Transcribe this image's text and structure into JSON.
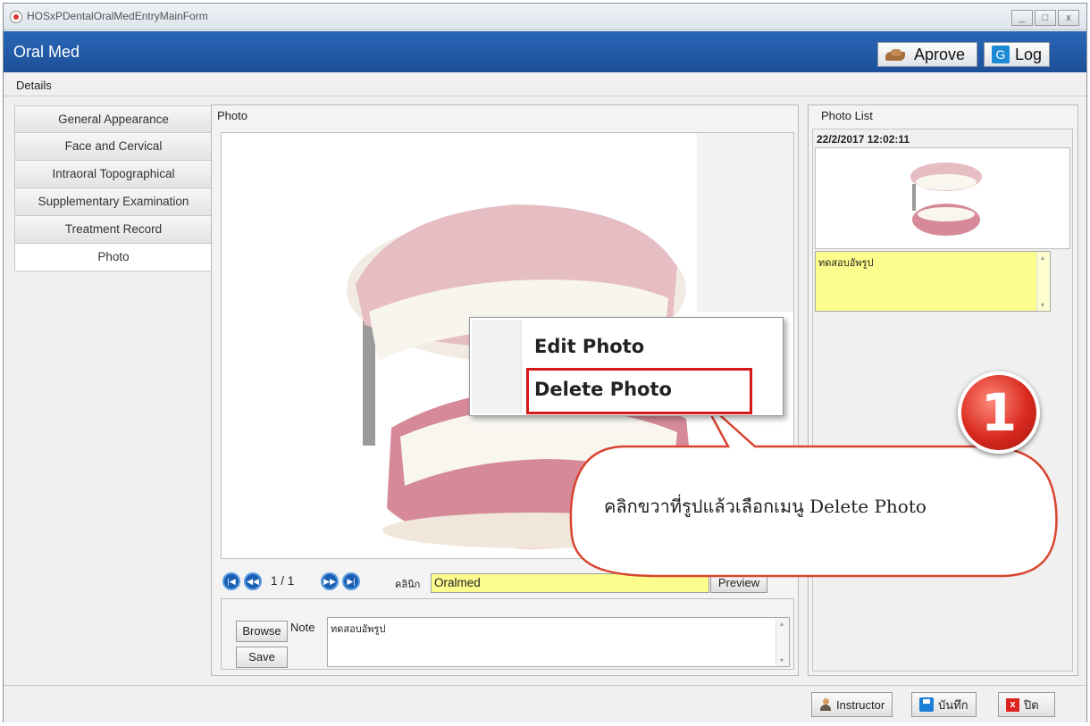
{
  "window": {
    "title": "HOSxPDentalOralMedEntryMainForm",
    "buttons": [
      "_",
      "□",
      "x"
    ]
  },
  "header": {
    "title": "Oral Med",
    "approve_label": "Aprove",
    "log_label": "Log",
    "log_icon_glyph": "G"
  },
  "details_label": "Details",
  "sidebar": {
    "items": [
      {
        "label": "General Appearance"
      },
      {
        "label": "Face and Cervical"
      },
      {
        "label": "Intraoral Topographical"
      },
      {
        "label": "Supplementary Examination"
      },
      {
        "label": "Treatment Record"
      },
      {
        "label": "Photo",
        "active": true
      }
    ]
  },
  "photo_panel": {
    "title": "Photo",
    "pager": "1 / 1",
    "clinic_label": "คลินิก",
    "clinic_value": "Oralmed",
    "preview_label": "Preview",
    "browse_label": "Browse",
    "save_label": "Save",
    "note_label": "Note",
    "note_value": "ทดสอบอัพรูป"
  },
  "photo_list": {
    "title": "Photo List",
    "items": [
      {
        "datetime": "22/2/2017 12:02:11",
        "note": "ทดสอบอัพรูป"
      }
    ]
  },
  "context_menu": {
    "items": [
      "Edit Photo",
      "Delete Photo"
    ],
    "highlighted": "Delete Photo"
  },
  "callout": {
    "number": "1",
    "text": "คลิกขวาที่รูปแล้วเลือกเมนู Delete Photo"
  },
  "footer": {
    "instructor_label": "Instructor",
    "save_label": "บันทึก",
    "close_label": "ปิด",
    "close_glyph": "x"
  },
  "colors": {
    "header_blue": "#1b4f98",
    "field_yellow": "#fdfd8e",
    "highlight_red": "#d61a1a",
    "callout_red": "#d92a1e"
  },
  "icons": [
    "app-icon",
    "approve-hand-icon",
    "log-icon",
    "first-page-icon",
    "prev-page-icon",
    "next-page-icon",
    "last-page-icon",
    "user-icon",
    "save-icon",
    "close-icon"
  ]
}
